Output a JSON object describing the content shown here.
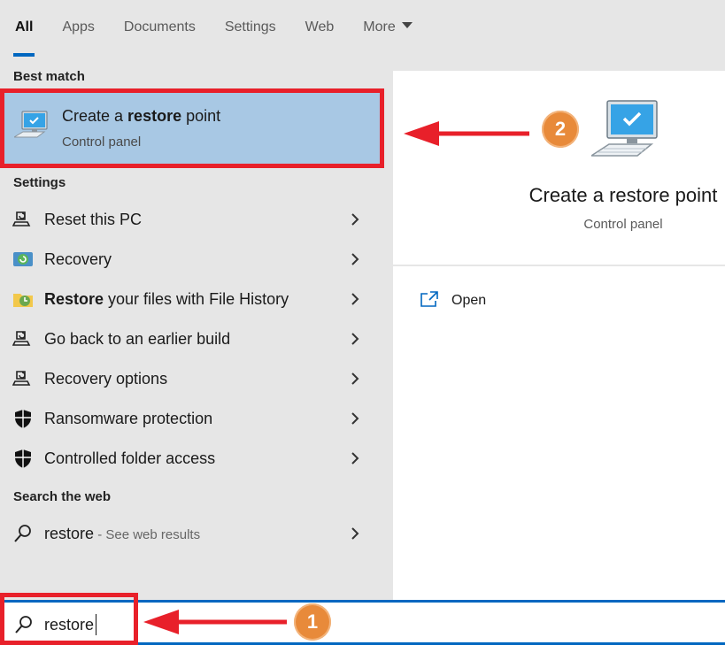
{
  "tabs": [
    {
      "label": "All",
      "active": true
    },
    {
      "label": "Apps"
    },
    {
      "label": "Documents"
    },
    {
      "label": "Settings"
    },
    {
      "label": "Web"
    },
    {
      "label": "More"
    }
  ],
  "best_match": {
    "section_label": "Best match",
    "title_pre": "Create a ",
    "title_bold": "restore",
    "title_post": " point",
    "subtitle": "Control panel",
    "icon": "computer-checkmark-icon"
  },
  "settings": {
    "section_label": "Settings",
    "items": [
      {
        "pre": "",
        "bold": "",
        "post": "Reset this PC",
        "icon": "reset-pc-icon"
      },
      {
        "pre": "",
        "bold": "",
        "post": "Recovery",
        "icon": "recovery-icon"
      },
      {
        "pre": "",
        "bold": "Restore",
        "post": " your files with File History",
        "icon": "file-history-icon"
      },
      {
        "pre": "",
        "bold": "",
        "post": "Go back to an earlier build",
        "icon": "reset-pc-icon"
      },
      {
        "pre": "",
        "bold": "",
        "post": "Recovery options",
        "icon": "reset-pc-icon"
      },
      {
        "pre": "",
        "bold": "",
        "post": "Ransomware protection",
        "icon": "shield-icon"
      },
      {
        "pre": "",
        "bold": "",
        "post": "Controlled folder access",
        "icon": "shield-icon"
      }
    ]
  },
  "web": {
    "section_label": "Search the web",
    "query": "restore",
    "hint": " - See web results"
  },
  "preview": {
    "title": "Create a restore point",
    "subtitle": "Control panel",
    "action_open": "Open"
  },
  "search": {
    "value": "restore"
  },
  "annotations": {
    "badge_1": "1",
    "badge_2": "2",
    "highlight_color": "#e8202a",
    "badge_color": "#e88a3a"
  },
  "colors": {
    "accent": "#0067c0",
    "selection": "#a8c8e4"
  }
}
